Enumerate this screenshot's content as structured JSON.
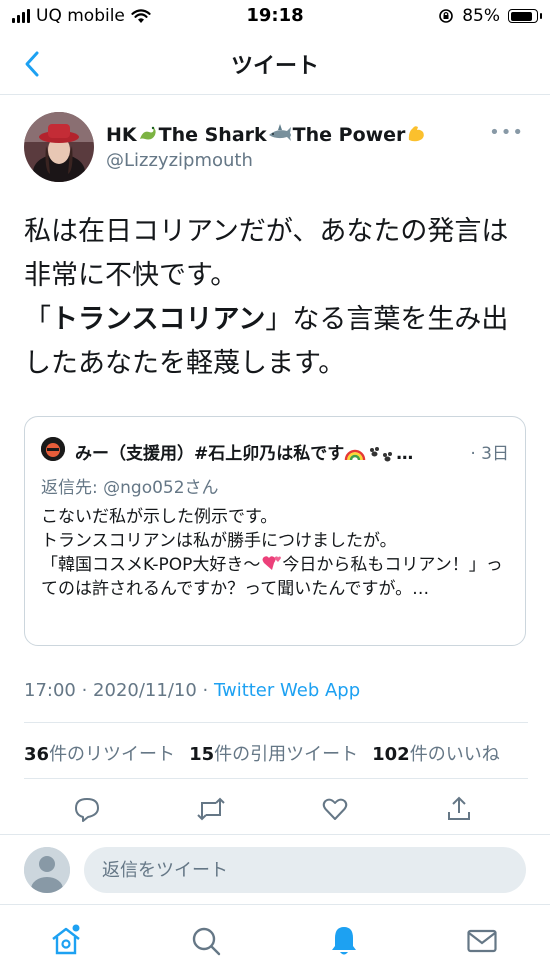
{
  "status_bar": {
    "carrier": "UQ mobile",
    "time": "19:18",
    "battery_percent": "85%",
    "battery_level": 0.85
  },
  "nav": {
    "title": "ツイート",
    "back_icon": "chevron-left-icon"
  },
  "author": {
    "name_part1": "HK",
    "name_part2": "The Shark",
    "name_part3": "The Power",
    "handle": "@Lizzyzipmouth",
    "more_label": "•••"
  },
  "tweet": {
    "line1": "私は在日コリアンだが、あなたの発言は非常に不快です。",
    "line2_open": "「",
    "line2_bold": "トランスコリアン",
    "line2_rest": "」なる言葉を生み出したあなたを軽蔑します。"
  },
  "quote": {
    "name": "みー（支援用）#石上卯乃は私です",
    "name_suffix": "…",
    "date": "· 3日",
    "reply_to": "返信先: @ngo052さん",
    "body_line1": "こないだ私が示した例示です。",
    "body_line2": "トランスコリアンは私が勝手につけましたが。",
    "body_line3a": "「韓国コスメK-POP大好き〜",
    "body_line3b": "今日から私もコリアン！」ってのは許されるんですか？って聞いたんですが。…"
  },
  "meta": {
    "timestamp": "17:00 · 2020/11/10 · ",
    "app": "Twitter Web App"
  },
  "stats": {
    "retweets_count": "36",
    "retweets_label": "件のリツイート",
    "quotes_count": "15",
    "quotes_label": "件の引用ツイート",
    "likes_count": "102",
    "likes_label": "件のいいね"
  },
  "actions": [
    "reply-icon",
    "retweet-icon",
    "like-icon",
    "share-icon"
  ],
  "reply_bar": {
    "placeholder": "返信をツイート"
  },
  "tab_bar": [
    "home-icon",
    "search-icon",
    "notifications-icon",
    "messages-icon"
  ],
  "colors": {
    "accent": "#1da1f2",
    "secondary_text": "#657786",
    "divider": "#e1e8ed"
  }
}
